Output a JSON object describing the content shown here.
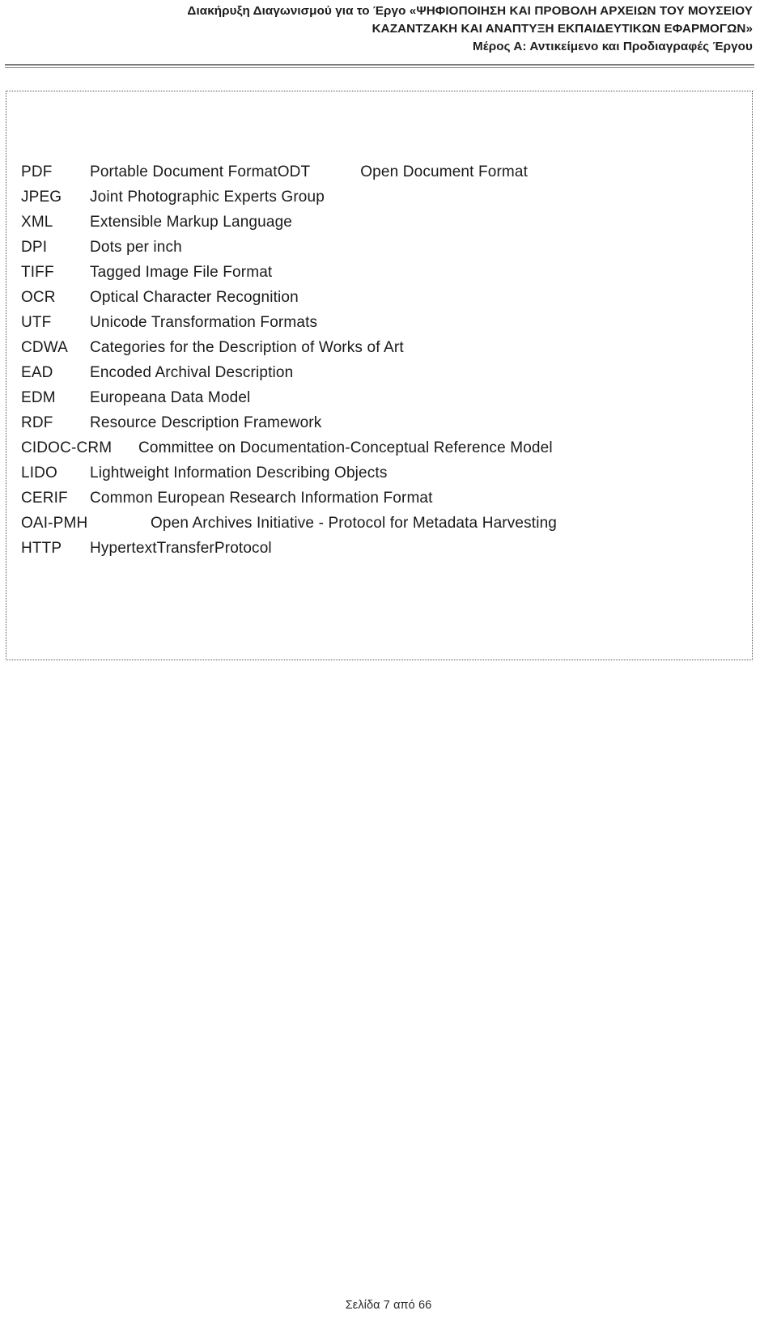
{
  "header": {
    "line1": "Διακήρυξη Διαγωνισμού για το Έργο «ΨΗΦΙΟΠΟΙΗΣΗ ΚΑΙ ΠΡΟΒΟΛΗ ΑΡΧΕΙΩΝ ΤΟΥ ΜΟΥΣΕΙΟΥ",
    "line2": "ΚΑΖΑΝΤΖΑΚΗ ΚΑΙ ΑΝΑΠΤΥΞΗ ΕΚΠΑΙΔΕΥΤΙΚΩΝ ΕΦΑΡΜΟΓΩΝ»",
    "line3": "Μέρος Α: Αντικείμενο και Προδιαγραφές Έργου"
  },
  "content": {
    "abbreviations": [
      {
        "term": "PDF",
        "expansion": "Portable Document FormatODT",
        "extra_term": "",
        "extra_expansion": "Open Document Format"
      },
      {
        "term": "JPEG",
        "expansion": "Joint Photographic Experts Group",
        "extra_term": "",
        "extra_expansion": ""
      },
      {
        "term": "XML",
        "expansion": "Extensible Markup Language",
        "extra_term": "",
        "extra_expansion": ""
      },
      {
        "term": "DPI",
        "expansion": "Dots per inch",
        "extra_term": "",
        "extra_expansion": ""
      },
      {
        "term": "TIFF",
        "expansion": "Tagged Image File Format",
        "extra_term": "",
        "extra_expansion": ""
      },
      {
        "term": "OCR",
        "expansion": "Optical Character Recognition",
        "extra_term": "",
        "extra_expansion": ""
      },
      {
        "term": "UTF",
        "expansion": "Unicode Transformation Formats",
        "extra_term": "",
        "extra_expansion": ""
      },
      {
        "term": "CDWA",
        "expansion": "Categories for the Description of Works of Art",
        "extra_term": "",
        "extra_expansion": ""
      },
      {
        "term": "EAD",
        "expansion": "Encoded Archival Description",
        "extra_term": "",
        "extra_expansion": ""
      },
      {
        "term": "EDM",
        "expansion": "Europeana Data Model",
        "extra_term": "",
        "extra_expansion": ""
      },
      {
        "term": "RDF",
        "expansion": "Resource Description Framework",
        "extra_term": "",
        "extra_expansion": ""
      },
      {
        "term": "CIDOC-CRM",
        "expansion": "Committee on Documentation-Conceptual Reference Model",
        "extra_term": "",
        "extra_expansion": ""
      },
      {
        "term": "LIDO",
        "expansion": "Lightweight Information Describing Objects",
        "extra_term": "",
        "extra_expansion": ""
      },
      {
        "term": "CERIF",
        "expansion": "Common European Research Information Format",
        "extra_term": "",
        "extra_expansion": ""
      },
      {
        "term": "OAI-PMH",
        "expansion": "Open Archives Initiative - Protocol for Metadata Harvesting",
        "extra_term": "",
        "extra_expansion": ""
      },
      {
        "term": "HTTP",
        "expansion": "HypertextTransferProtocol",
        "extra_term": "",
        "extra_expansion": ""
      }
    ]
  },
  "footer": {
    "page_label": "Σελίδα 7 από 66"
  },
  "colors": {
    "text": "#1a1a1a",
    "header_rule": "#7b7b7b",
    "frame_border": "#555555",
    "page_background": "#ffffff"
  }
}
